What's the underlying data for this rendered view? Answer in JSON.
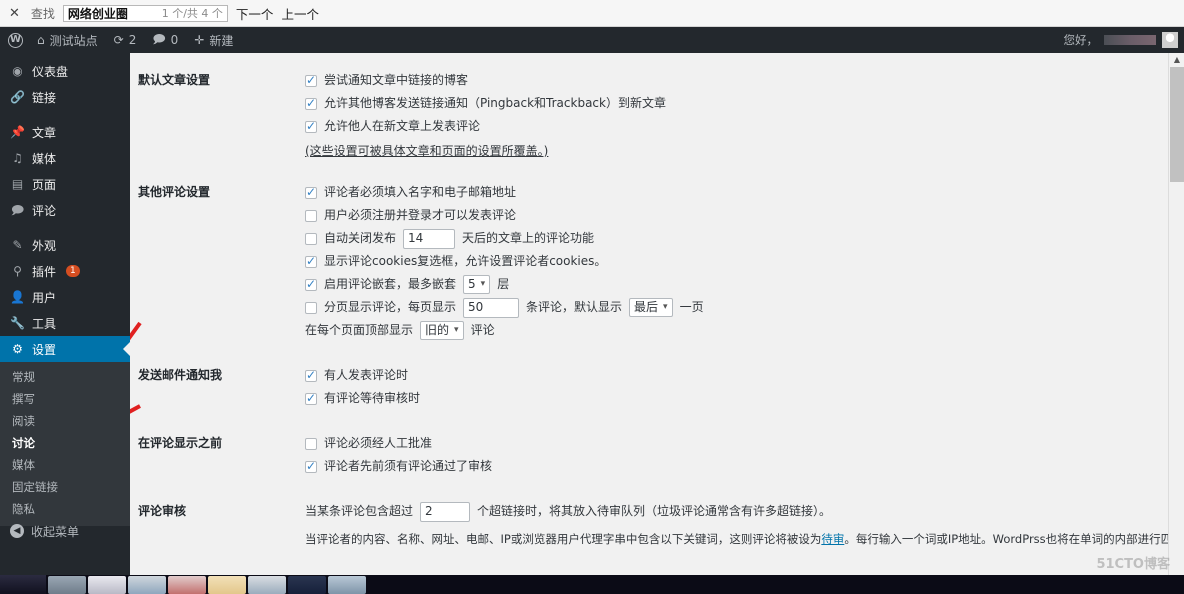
{
  "findbar": {
    "close_icon": "close-icon",
    "label": "查找",
    "query": "网络创业圈",
    "count": "1 个/共 4 个",
    "next": "下一个",
    "prev": "上一个"
  },
  "adminbar": {
    "logo_glyph": "W",
    "home_icon": "home-icon",
    "site_name": "测试站点",
    "updates_icon": "updates-icon",
    "updates_count": "2",
    "comments_icon": "comment-bubble-icon",
    "comments_count": "0",
    "new_icon": "plus-icon",
    "new_label": "新建",
    "greeting": "您好，",
    "avatar": "avatar"
  },
  "sidebar": {
    "items": [
      {
        "label": "仪表盘",
        "icon": "dashboard-icon",
        "badge": ""
      },
      {
        "label": "链接",
        "icon": "link-icon",
        "badge": ""
      },
      {
        "label": "文章",
        "icon": "pin-icon",
        "badge": ""
      },
      {
        "label": "媒体",
        "icon": "media-icon",
        "badge": ""
      },
      {
        "label": "页面",
        "icon": "page-icon",
        "badge": ""
      },
      {
        "label": "评论",
        "icon": "comment-icon",
        "badge": ""
      },
      {
        "label": "外观",
        "icon": "appearance-brush-icon",
        "badge": ""
      },
      {
        "label": "插件",
        "icon": "plugin-icon",
        "badge": "1"
      },
      {
        "label": "用户",
        "icon": "user-icon",
        "badge": ""
      },
      {
        "label": "工具",
        "icon": "tools-wrench-icon",
        "badge": ""
      },
      {
        "label": "设置",
        "icon": "settings-icon",
        "badge": ""
      }
    ],
    "submenu": [
      "常规",
      "撰写",
      "阅读",
      "讨论",
      "媒体",
      "固定链接",
      "隐私"
    ],
    "submenu_active": "讨论",
    "collapse_label": "收起菜单",
    "collapse_icon": "chevron-left-icon"
  },
  "main": {
    "sections": {
      "default_post": {
        "label": "默认文章设置",
        "options": [
          {
            "text": "尝试通知文章中链接的博客",
            "checked": true
          },
          {
            "text": "允许其他博客发送链接通知（Pingback和Trackback）到新文章",
            "checked": true
          },
          {
            "text": "允许他人在新文章上发表评论",
            "checked": true
          }
        ],
        "note": "(这些设置可被具体文章和页面的设置所覆盖。)"
      },
      "other_comment": {
        "label": "其他评论设置",
        "opt1": {
          "text": "评论者必须填入名字和电子邮箱地址",
          "checked": true
        },
        "opt2": {
          "text": "用户必须注册并登录才可以发表评论",
          "checked": false
        },
        "opt3": {
          "checked": false,
          "pre": "自动关闭发布",
          "value": "14",
          "post": "天后的文章上的评论功能"
        },
        "opt4": {
          "text": "显示评论cookies复选框，允许设置评论者cookies。",
          "checked": true
        },
        "opt5": {
          "checked": true,
          "pre": "启用评论嵌套，最多嵌套",
          "value": "5",
          "post": "层"
        },
        "opt6": {
          "checked": false,
          "pre": "分页显示评论，每页显示",
          "value": "50",
          "mid": "条评论，默认显示",
          "select": "最后",
          "post": "一页"
        },
        "opt7": {
          "pre": "在每个页面顶部显示",
          "select": "旧的",
          "post": "评论"
        }
      },
      "email_me": {
        "label": "发送邮件通知我",
        "options": [
          {
            "text": "有人发表评论时",
            "checked": true
          },
          {
            "text": "有评论等待审核时",
            "checked": true
          }
        ]
      },
      "before_show": {
        "label": "在评论显示之前",
        "options": [
          {
            "text": "评论必须经人工批准",
            "checked": false
          },
          {
            "text": "评论者先前须有评论通过了审核",
            "checked": true
          }
        ]
      },
      "moderation": {
        "label": "评论审核",
        "pre": "当某条评论包含超过",
        "value": "2",
        "post": "个超链接时，将其放入待审队列（垃圾评论通常含有许多超链接）。",
        "desc_pre": "当评论者的内容、名称、网址、电邮、IP或浏览器用户代理字串中包含以下关键词，这则评论将被设为",
        "desc_link": "待审",
        "desc_post": "。每行输入一个词或IP地址。WordPrss也将在单词的内部进行匹配，所"
      }
    }
  },
  "scrollbar": {
    "up_arrow": "chevron-up-icon"
  },
  "watermark": {
    "text": "51CTO博客"
  }
}
